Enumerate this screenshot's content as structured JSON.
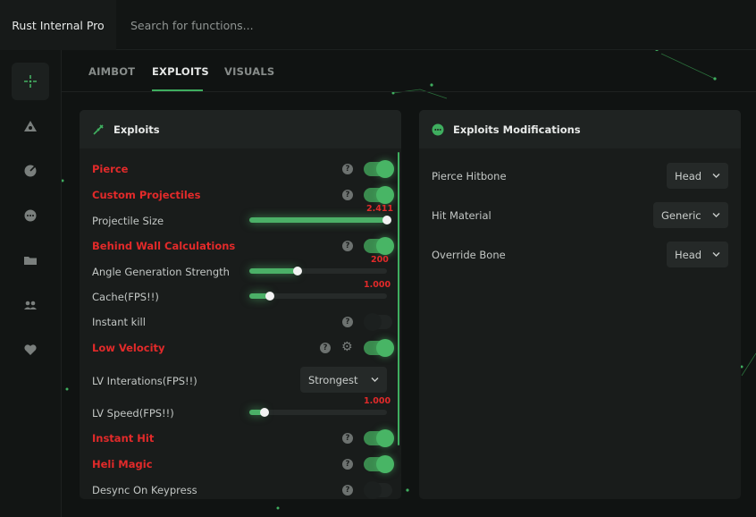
{
  "app": {
    "title": "Rust Internal Pro"
  },
  "search": {
    "placeholder": "Search for functions..."
  },
  "sidebar": {
    "items": [
      {
        "icon": "crosshair-icon",
        "active": true
      },
      {
        "icon": "eye-triangle-icon"
      },
      {
        "icon": "radar-icon"
      },
      {
        "icon": "chat-dots-icon"
      },
      {
        "icon": "folder-icon"
      },
      {
        "icon": "users-icon"
      },
      {
        "icon": "heart-icon"
      }
    ]
  },
  "tabs": [
    {
      "label": "AIMBOT"
    },
    {
      "label": "EXPLOITS",
      "active": true
    },
    {
      "label": "VISUALS"
    }
  ],
  "exploits_panel": {
    "title": "Exploits",
    "icon": "syringe-icon",
    "pierce": {
      "label": "Pierce",
      "enabled": true
    },
    "custom_projectiles": {
      "label": "Custom Projectiles",
      "enabled": true
    },
    "projectile_size": {
      "label": "Projectile Size",
      "value": "2.411",
      "fill": 1.0
    },
    "behind_wall": {
      "label": "Behind Wall Calculations",
      "enabled": true
    },
    "angle_strength": {
      "label": "Angle Generation Strength",
      "value": "200",
      "fill": 0.35
    },
    "cache": {
      "label": "Cache(FPS!!)",
      "value": "1.000",
      "fill": 0.15
    },
    "instant_kill": {
      "label": "Instant kill",
      "enabled": false
    },
    "low_velocity": {
      "label": "Low Velocity",
      "enabled": true
    },
    "lv_iterations": {
      "label": "LV Interations(FPS!!)",
      "selected": "Strongest"
    },
    "lv_speed": {
      "label": "LV Speed(FPS!!)",
      "value": "1.000",
      "fill": 0.11
    },
    "instant_hit": {
      "label": "Instant Hit",
      "enabled": true
    },
    "heli_magic": {
      "label": "Heli Magic",
      "enabled": true
    },
    "desync": {
      "label": "Desync On Keypress",
      "enabled": false
    },
    "help_glyph": "?",
    "gear_glyph": "⚙"
  },
  "modifications_panel": {
    "title": "Exploits Modifications",
    "icon": "chat-dots-icon",
    "pierce_hitbone": {
      "label": "Pierce Hitbone",
      "selected": "Head"
    },
    "hit_material": {
      "label": "Hit Material",
      "selected": "Generic"
    },
    "override_bone": {
      "label": "Override Bone",
      "selected": "Head"
    }
  },
  "colors": {
    "accent": "#3fae5f",
    "danger": "#e22a2a",
    "panel": "#191c1b"
  }
}
